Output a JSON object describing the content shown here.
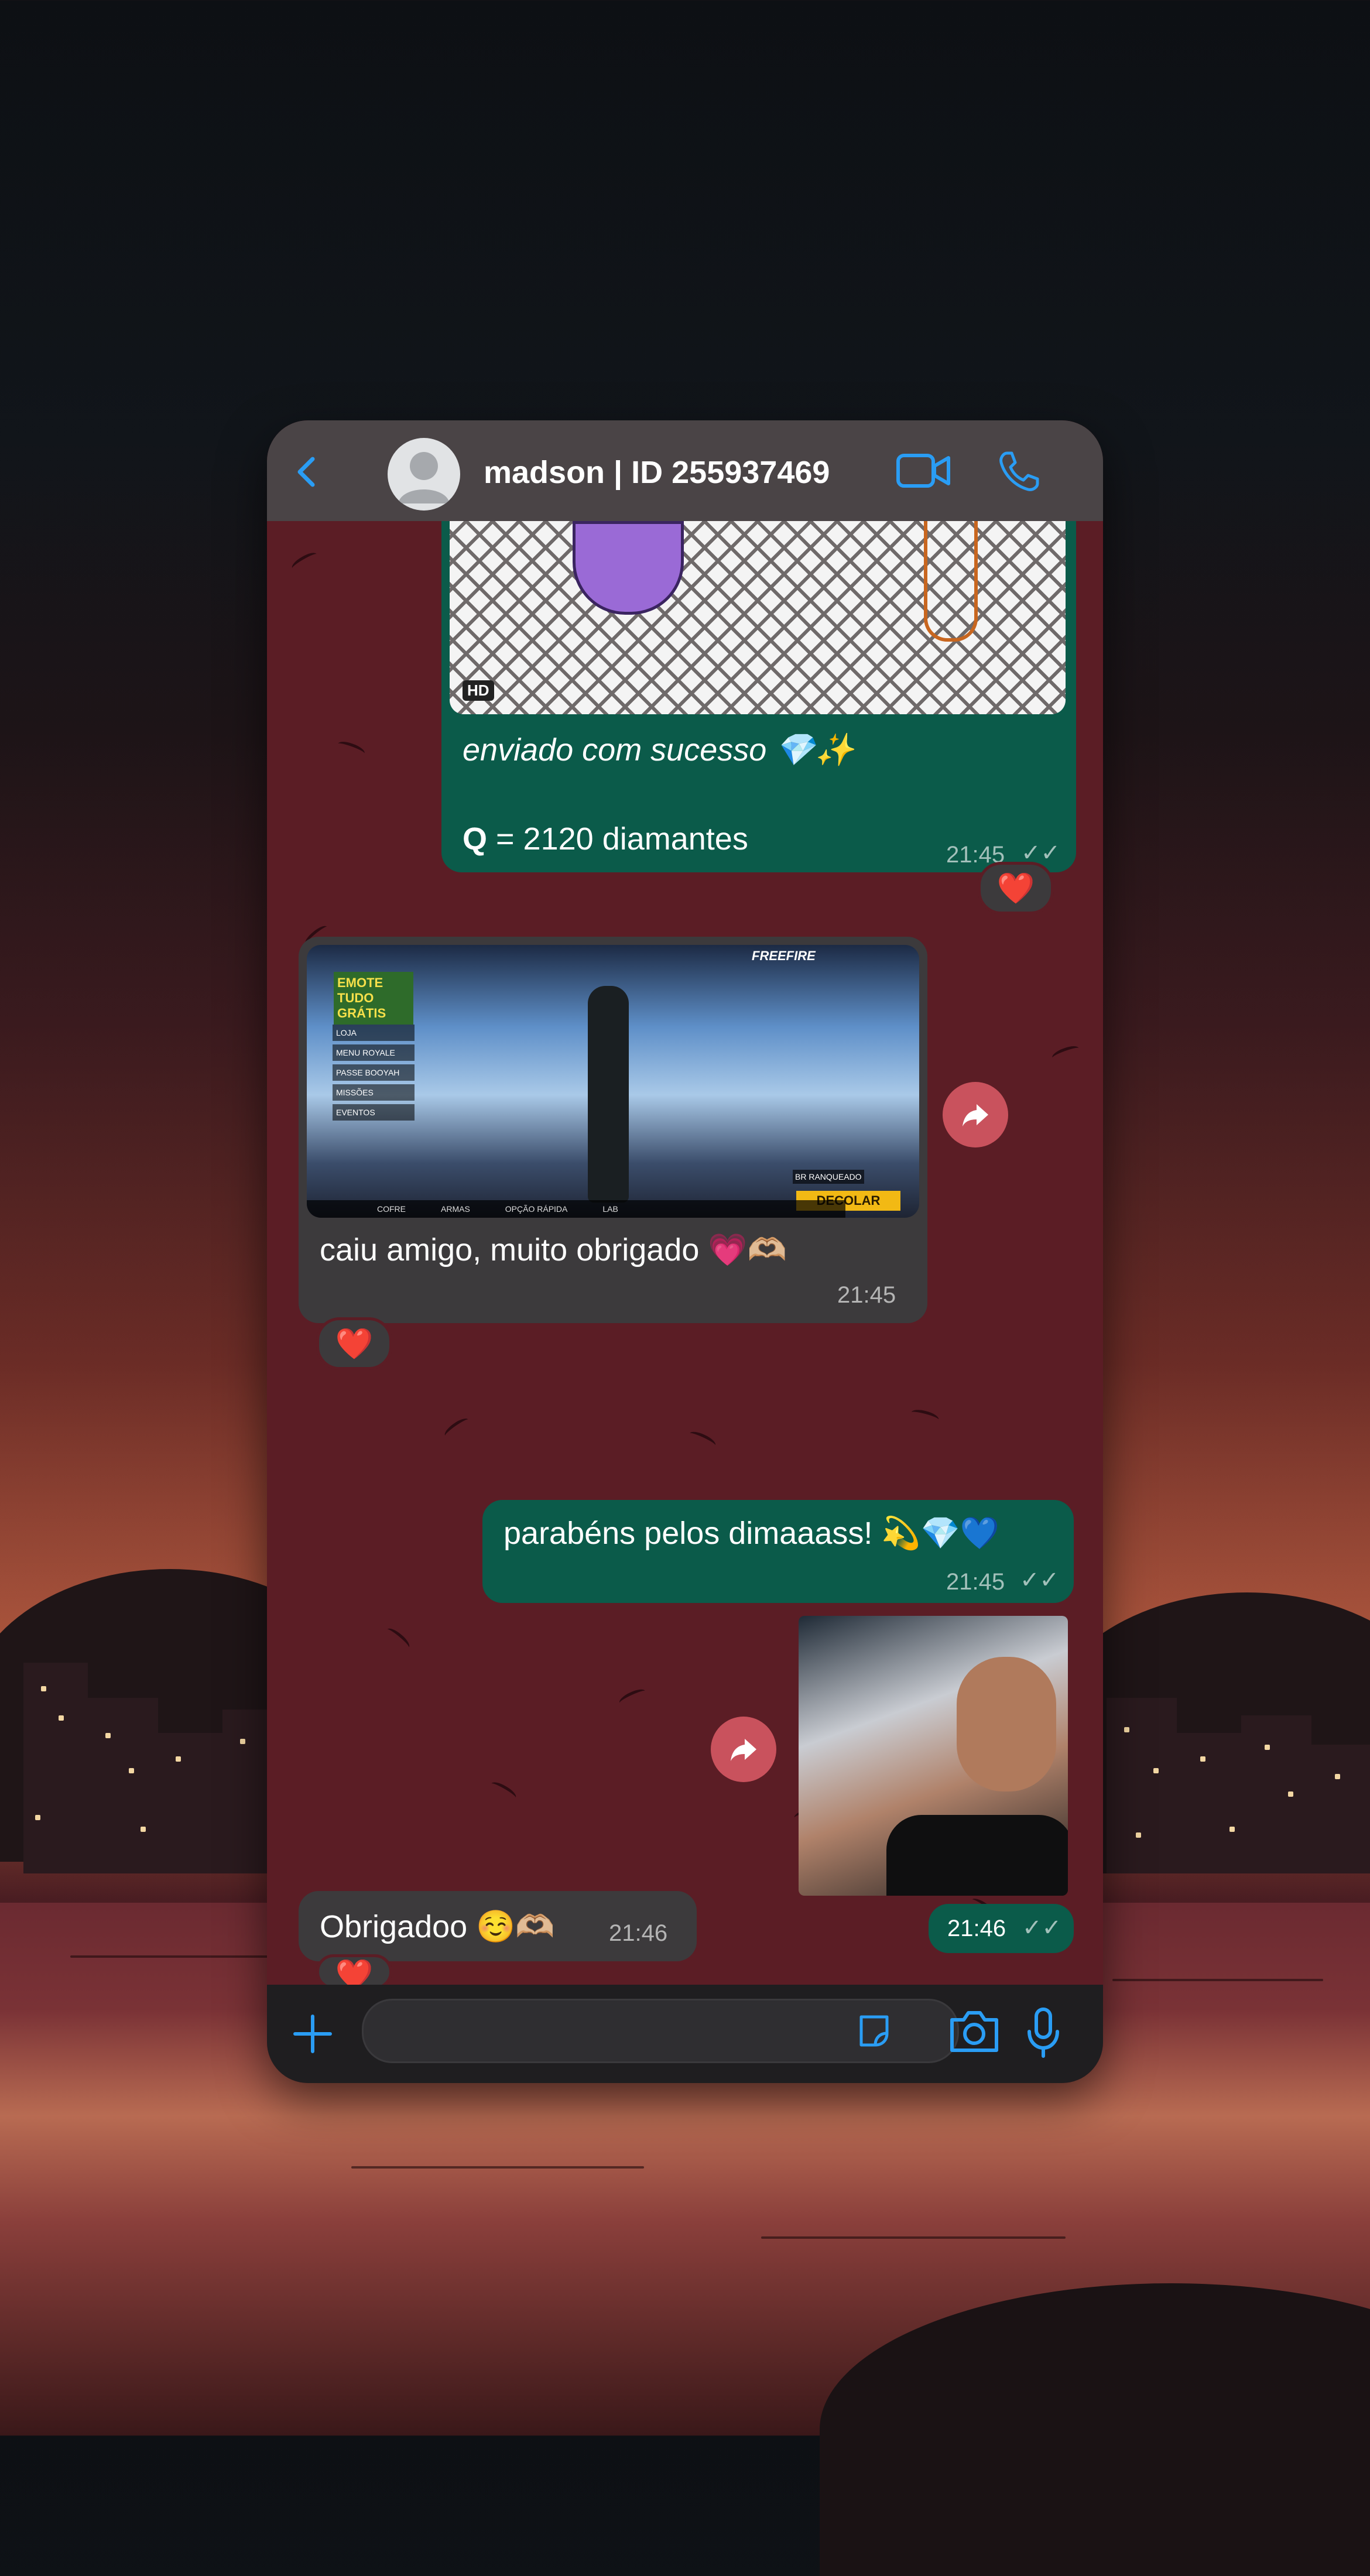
{
  "header": {
    "contact_name": "madson | ID 255937469",
    "back_icon": "chevron-left-icon",
    "video_icon": "video-camera-icon",
    "call_icon": "phone-icon"
  },
  "messages": {
    "m1": {
      "image_badge": "HD",
      "line1": "enviado com sucesso 💎✨",
      "line2_bold": "Q",
      "line2_rest": " = 2120 diamantes",
      "time": "21:45",
      "reaction": "❤️"
    },
    "m2": {
      "image_texts": {
        "logo": "FREEFIRE",
        "promo": "EMOTE TUDO GRÁTIS",
        "menu": [
          "LOJA",
          "MENU ROYALE",
          "PASSE BOOYAH",
          "MISSÕES",
          "EVENTOS"
        ],
        "mode": "BR RANQUEADO",
        "button": "DECOLAR",
        "bottom": [
          "COFRE",
          "ARMAS",
          "OPÇÃO RÁPIDA",
          "LAB"
        ]
      },
      "text": "caiu amigo, muito obrigado 💗🫶🏼",
      "time": "21:45",
      "reaction": "❤️"
    },
    "m3": {
      "text": "parabéns pelos dimaaass! 💫💎💙",
      "time": "21:45"
    },
    "m4": {
      "time": "21:46"
    },
    "m5": {
      "text": "Obrigadoo ☺️🫶🏼",
      "time": "21:46",
      "reaction": "❤️"
    }
  },
  "composer": {
    "placeholder": "",
    "add_icon": "plus-icon",
    "sticker_icon": "sticker-icon",
    "camera_icon": "camera-icon",
    "mic_icon": "microphone-icon"
  },
  "colors": {
    "accent": "#2a9df4",
    "outgoing_bubble": "#0b5b4a",
    "incoming_bubble": "#3c3a3c",
    "forward_button": "#c9525d"
  }
}
